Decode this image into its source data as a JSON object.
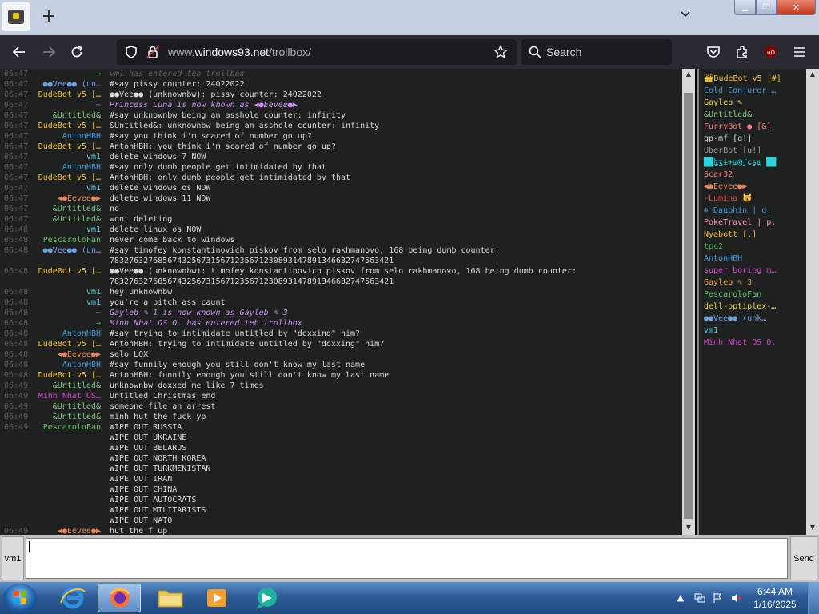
{
  "browser": {
    "new_tab_label": "+",
    "url_prefix": "www.",
    "url_domain": "windows93.net",
    "url_path": "/trollbox/",
    "search_placeholder": "Search",
    "tabs_list_label": "⌄"
  },
  "window_controls": {
    "minimize": "▁",
    "maximize": "❐",
    "close": "✕"
  },
  "chat": {
    "messages": [
      {
        "time": "06:47",
        "nick": "",
        "nick_color": "#3cb043",
        "text": "vm1 has entered teh trollbox",
        "text_color": "#5d5d5d",
        "italic": true,
        "arrow": "→"
      },
      {
        "time": "06:47",
        "nick": "●●Vee●● (un…",
        "nick_color": "#6ca0dc",
        "text": "#say pissy counter: 24022022"
      },
      {
        "time": "06:47",
        "nick": "DudeBot v5 […",
        "nick_color": "#f2c12e",
        "text": "●●Vee●● (unknownbw): pissy counter: 24022022"
      },
      {
        "time": "06:47",
        "nick": "~",
        "nick_color": "#c86ad8",
        "text": "Princess Luna is now known as ◀●Eevee●▶",
        "text_color": "#c98ef0",
        "italic": true
      },
      {
        "time": "06:47",
        "nick": "&Untitled&",
        "nick_color": "#7bc47f",
        "text": "#say unknownbw being an asshole counter: infinity"
      },
      {
        "time": "06:47",
        "nick": "DudeBot v5 […",
        "nick_color": "#f2c12e",
        "text": "&Untitled&: unknownbw being an asshole counter: infinity"
      },
      {
        "time": "06:47",
        "nick": "AntonHBH",
        "nick_color": "#3b9be0",
        "text": "#say you think i'm scared of number go up?"
      },
      {
        "time": "06:47",
        "nick": "DudeBot v5 […",
        "nick_color": "#f2c12e",
        "text": "AntonHBH: you think i'm scared of number go up?"
      },
      {
        "time": "06:47",
        "nick": "vm1",
        "nick_color": "#5fd3e8",
        "text": "delete windows 7 NOW"
      },
      {
        "time": "06:47",
        "nick": "AntonHBH",
        "nick_color": "#3b9be0",
        "text": "#say only dumb people get intimidated by that"
      },
      {
        "time": "06:47",
        "nick": "DudeBot v5 […",
        "nick_color": "#f2c12e",
        "text": "AntonHBH: only dumb people get intimidated by that"
      },
      {
        "time": "06:47",
        "nick": "vm1",
        "nick_color": "#5fd3e8",
        "text": "delete windows os NOW"
      },
      {
        "time": "06:47",
        "nick": "◀●Eevee●▶",
        "nick_color": "#e8875a",
        "text": "delete windows 11 NOW"
      },
      {
        "time": "06:47",
        "nick": "&Untitled&",
        "nick_color": "#7bc47f",
        "text": "no"
      },
      {
        "time": "06:47",
        "nick": "&Untitled&",
        "nick_color": "#7bc47f",
        "text": "wont deleting"
      },
      {
        "time": "06:48",
        "nick": "vm1",
        "nick_color": "#5fd3e8",
        "text": "delete linux os NOW"
      },
      {
        "time": "06:48",
        "nick": "PescaroloFan",
        "nick_color": "#5ec95e",
        "text": "never come back to windows"
      },
      {
        "time": "06:48",
        "nick": "●●Vee●● (un…",
        "nick_color": "#6ca0dc",
        "text": "#say timofey konstantinovich piskov from selo rakhmanovo, 168 being dumb counter:"
      },
      {
        "time": "",
        "nick": "",
        "nick_color": "#6ca0dc",
        "text": "78327632768567432567315671235671230893147891346632747563421"
      },
      {
        "time": "06:48",
        "nick": "DudeBot v5 […",
        "nick_color": "#f2c12e",
        "text": "●●Vee●● (unknownbw): timofey konstantinovich piskov from selo rakhmanovo, 168 being dumb counter:"
      },
      {
        "time": "",
        "nick": "",
        "nick_color": "#f2c12e",
        "text": "78327632768567432567315671235671230893147891346632747563421"
      },
      {
        "time": "06:48",
        "nick": "vm1",
        "nick_color": "#5fd3e8",
        "text": "hey unknownbw"
      },
      {
        "time": "06:48",
        "nick": "vm1",
        "nick_color": "#5fd3e8",
        "text": "you're a bitch ass caunt"
      },
      {
        "time": "06:48",
        "nick": "~",
        "nick_color": "#c86ad8",
        "text": "Gayleb ✎ 1 is now known as Gayleb ✎ 3",
        "text_color": "#c98ef0",
        "italic": true
      },
      {
        "time": "06:48",
        "nick": "",
        "nick_color": "#3cb043",
        "text": "Minh Nhat OS O. has entered teh trollbox",
        "text_color": "#c98ef0",
        "italic": true,
        "arrow": "→"
      },
      {
        "time": "06:48",
        "nick": "AntonHBH",
        "nick_color": "#3b9be0",
        "text": "#say trying to intimidate untitled by \"doxxing\" him?"
      },
      {
        "time": "06:48",
        "nick": "DudeBot v5 […",
        "nick_color": "#f2c12e",
        "text": "AntonHBH: trying to intimidate untitled by \"doxxing\" him?"
      },
      {
        "time": "06:48",
        "nick": "◀●Eevee●▶",
        "nick_color": "#e8875a",
        "text": "selo LOX"
      },
      {
        "time": "06:48",
        "nick": "AntonHBH",
        "nick_color": "#3b9be0",
        "text": "#say funnily enough you still don't know my last name"
      },
      {
        "time": "06:48",
        "nick": "DudeBot v5 […",
        "nick_color": "#f2c12e",
        "text": "AntonHBH: funnily enough you still don't know my last name"
      },
      {
        "time": "06:49",
        "nick": "&Untitled&",
        "nick_color": "#7bc47f",
        "text": "unknownbw doxxed me like 7 times"
      },
      {
        "time": "06:49",
        "nick": "Minh Nhat OS…",
        "nick_color": "#d640d6",
        "text": "Untitled Christmas end"
      },
      {
        "time": "06:49",
        "nick": "&Untitled&",
        "nick_color": "#7bc47f",
        "text": "someone file an arrest"
      },
      {
        "time": "06:49",
        "nick": "&Untitled&",
        "nick_color": "#7bc47f",
        "text": "minh hut the fuck yp"
      },
      {
        "time": "06:49",
        "nick": "PescaroloFan",
        "nick_color": "#5ec95e",
        "text": "WIPE OUT RUSSIA"
      },
      {
        "time": "",
        "nick": "",
        "nick_color": "#5ec95e",
        "text": "WIPE OUT UKRAINE"
      },
      {
        "time": "",
        "nick": "",
        "nick_color": "#5ec95e",
        "text": "WIPE OUT BELARUS"
      },
      {
        "time": "",
        "nick": "",
        "nick_color": "#5ec95e",
        "text": "WIPE OUT NORTH KOREA"
      },
      {
        "time": "",
        "nick": "",
        "nick_color": "#5ec95e",
        "text": "WIPE OUT TURKMENISTAN"
      },
      {
        "time": "",
        "nick": "",
        "nick_color": "#5ec95e",
        "text": "WIPE OUT IRAN"
      },
      {
        "time": "",
        "nick": "",
        "nick_color": "#5ec95e",
        "text": "WIPE OUT CHINA"
      },
      {
        "time": "",
        "nick": "",
        "nick_color": "#5ec95e",
        "text": "WIPE OUT AUTOCRATS"
      },
      {
        "time": "",
        "nick": "",
        "nick_color": "#5ec95e",
        "text": "WIPE OUT MILITARISTS"
      },
      {
        "time": "",
        "nick": "",
        "nick_color": "#5ec95e",
        "text": "WIPE OUT NATO"
      },
      {
        "time": "06:49",
        "nick": "◀●Eevee●▶",
        "nick_color": "#e8875a",
        "text": "hut the f up"
      }
    ]
  },
  "users": [
    {
      "name": "👑DudeBot v5 [#]",
      "color": "#f2c12e"
    },
    {
      "name": "Cold Conjurer …",
      "color": "#3b9be0"
    },
    {
      "name": "Gayleb ✎",
      "color": "#e8d84a"
    },
    {
      "name": "&Untitled&",
      "color": "#7bc47f"
    },
    {
      "name": "FurryBot ● [&]",
      "color": "#ff8080"
    },
    {
      "name": "qp-mf [q!]",
      "color": "#d8d8d8"
    },
    {
      "name": "UberBot [u!]",
      "color": "#9a9a9a"
    },
    {
      "name": "██ɮʓɨ+ɰ@ʆɕʂɰ ██",
      "color": "#26d7e0"
    },
    {
      "name": "Scar32",
      "color": "#ff8080"
    },
    {
      "name": "◀●Eevee●▶",
      "color": "#e8875a"
    },
    {
      "name": "-Lumina 🐱",
      "color": "#e84848"
    },
    {
      "name": "❄ Dauphin | d.",
      "color": "#3b9be0"
    },
    {
      "name": "PokéTravel | p.",
      "color": "#ff9ac4"
    },
    {
      "name": "Nyabott [.]",
      "color": "#f2c12e"
    },
    {
      "name": "tpc2",
      "color": "#3cb043"
    },
    {
      "name": "AntonHBH",
      "color": "#3b9be0"
    },
    {
      "name": "super boring m…",
      "color": "#d640d6"
    },
    {
      "name": "Gayleb ✎ 3",
      "color": "#f2a040"
    },
    {
      "name": "PescaroloFan",
      "color": "#5ec95e"
    },
    {
      "name": "dell-optiplex-…",
      "color": "#e8d84a"
    },
    {
      "name": "●●Vee●● (unk…",
      "color": "#6ca0dc"
    },
    {
      "name": "vm1",
      "color": "#5fd3e8"
    },
    {
      "name": "Minh Nhat OS O.",
      "color": "#d640d6"
    }
  ],
  "input": {
    "nick_label": "vm1",
    "value": "",
    "send_label": "Send"
  },
  "taskbar": {
    "apps": [
      {
        "name": "internet-explorer",
        "active": false
      },
      {
        "name": "firefox",
        "active": true
      },
      {
        "name": "file-explorer",
        "active": false
      },
      {
        "name": "media-player",
        "active": false
      },
      {
        "name": "chat-app",
        "active": false
      }
    ],
    "clock_time": "6:44 AM",
    "clock_date": "1/16/2025"
  }
}
